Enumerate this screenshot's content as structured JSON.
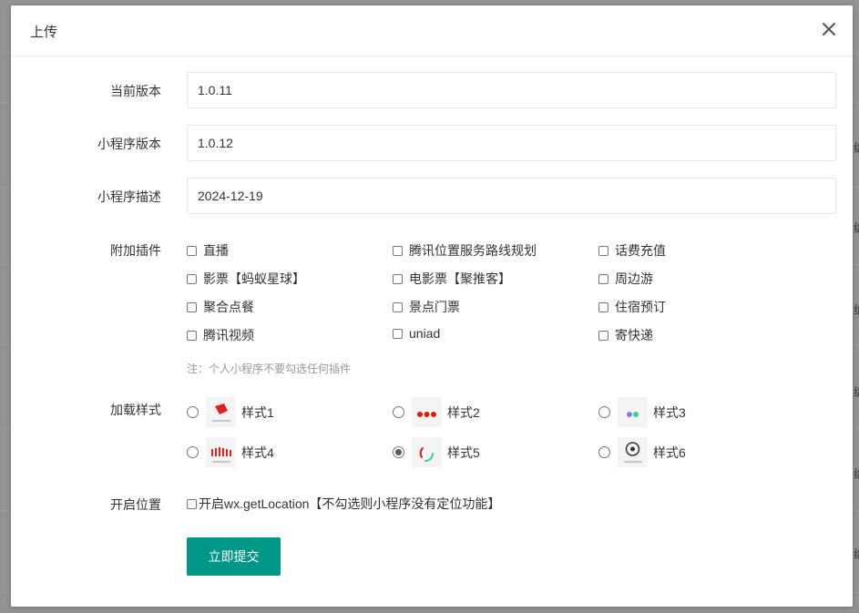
{
  "dialog": {
    "title": "上传",
    "close_icon": "close-icon"
  },
  "form": {
    "current_version": {
      "label": "当前版本",
      "value": "1.0.11"
    },
    "miniapp_version": {
      "label": "小程序版本",
      "value": "1.0.12"
    },
    "miniapp_desc": {
      "label": "小程序描述",
      "value": "2024-12-19"
    },
    "plugins": {
      "label": "附加插件",
      "items": [
        {
          "label": "直播",
          "checked": false
        },
        {
          "label": "腾讯位置服务路线规划",
          "checked": false
        },
        {
          "label": "话费充值",
          "checked": false
        },
        {
          "label": "影票【蚂蚁星球】",
          "checked": false
        },
        {
          "label": "电影票【聚推客】",
          "checked": false
        },
        {
          "label": "周边游",
          "checked": false
        },
        {
          "label": "聚合点餐",
          "checked": false
        },
        {
          "label": "景点门票",
          "checked": false
        },
        {
          "label": "住宿预订",
          "checked": false
        },
        {
          "label": "腾讯视频",
          "checked": false
        },
        {
          "label": "uniad",
          "checked": false
        },
        {
          "label": "寄快递",
          "checked": false
        }
      ],
      "hint": "注：个人小程序不要勾选任何插件"
    },
    "loading_style": {
      "label": "加载样式",
      "options": [
        {
          "label": "样式1",
          "checked": false
        },
        {
          "label": "样式2",
          "checked": false
        },
        {
          "label": "样式3",
          "checked": false
        },
        {
          "label": "样式4",
          "checked": false
        },
        {
          "label": "样式5",
          "checked": true
        },
        {
          "label": "样式6",
          "checked": false
        }
      ]
    },
    "location": {
      "label": "开启位置",
      "checkbox_label": "开启wx.getLocation【不勾选则小程序没有定位功能】",
      "checked": false
    },
    "submit_label": "立即提交"
  },
  "colors": {
    "primary": "#009688",
    "overlay": "#8a8a8a"
  }
}
